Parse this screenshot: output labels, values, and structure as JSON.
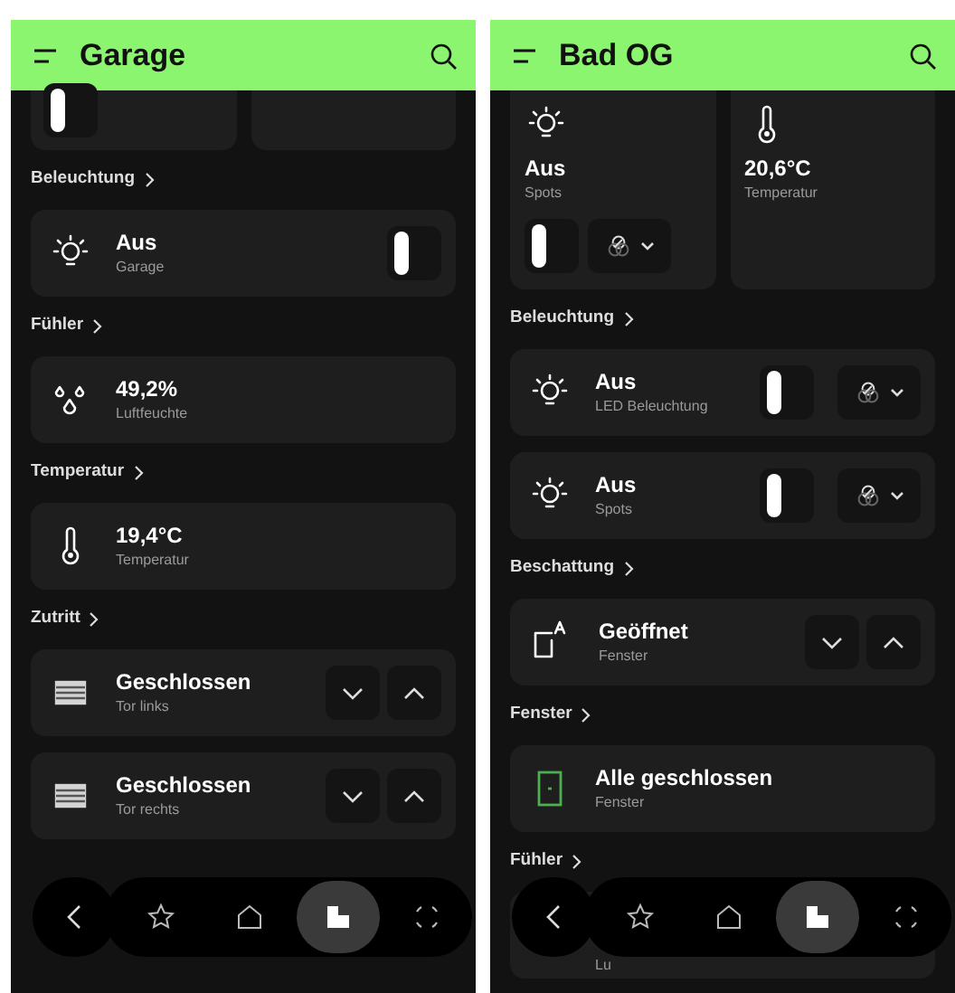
{
  "screens": [
    {
      "title": "Garage",
      "tiles": [
        {
          "kind": "stub",
          "toggle": {
            "on": false
          }
        },
        {
          "kind": "empty"
        }
      ],
      "sections": [
        {
          "heading": "Beleuchtung",
          "items": [
            {
              "kind": "light",
              "value": "Aus",
              "label": "Garage",
              "toggle": {
                "on": false
              }
            }
          ]
        },
        {
          "heading": "Fühler",
          "items": [
            {
              "kind": "humidity",
              "value": "49,2%",
              "label": "Luftfeuchte"
            }
          ]
        },
        {
          "heading": "Temperatur",
          "items": [
            {
              "kind": "temperature",
              "value": "19,4°C",
              "label": "Temperatur"
            }
          ]
        },
        {
          "heading": "Zutritt",
          "items": [
            {
              "kind": "gate",
              "value": "Geschlossen",
              "label": "Tor links"
            },
            {
              "kind": "gate",
              "value": "Geschlossen",
              "label": "Tor rechts"
            }
          ]
        }
      ],
      "nav": [
        {
          "kind": "star",
          "selected": false
        },
        {
          "kind": "home",
          "selected": false
        },
        {
          "kind": "rooms",
          "selected": true
        },
        {
          "kind": "scenes",
          "selected": false
        }
      ]
    },
    {
      "title": "Bad OG",
      "tiles": [
        {
          "kind": "light",
          "value": "Aus",
          "label": "Spots",
          "toggle": {
            "on": false
          },
          "color_menu": true
        },
        {
          "kind": "temperature",
          "value": "20,6°C",
          "label": "Temperatur"
        }
      ],
      "sections": [
        {
          "heading": "Beleuchtung",
          "items": [
            {
              "kind": "light",
              "value": "Aus",
              "label": "LED Beleuchtung",
              "toggle": {
                "on": false
              },
              "color_menu": true
            },
            {
              "kind": "light",
              "value": "Aus",
              "label": "Spots",
              "toggle": {
                "on": false
              },
              "color_menu": true
            }
          ]
        },
        {
          "heading": "Beschattung",
          "items": [
            {
              "kind": "shade",
              "value": "Geöffnet",
              "label": "Fenster"
            }
          ]
        },
        {
          "heading": "Fenster",
          "items": [
            {
              "kind": "window",
              "value": "Alle geschlossen",
              "label": "Fenster"
            }
          ]
        },
        {
          "heading": "Fühler",
          "items": [
            {
              "kind": "humidity_cut",
              "label": "Lu"
            }
          ]
        }
      ],
      "nav": [
        {
          "kind": "star",
          "selected": false
        },
        {
          "kind": "home",
          "selected": false
        },
        {
          "kind": "rooms",
          "selected": true
        },
        {
          "kind": "scenes",
          "selected": false
        }
      ]
    }
  ]
}
